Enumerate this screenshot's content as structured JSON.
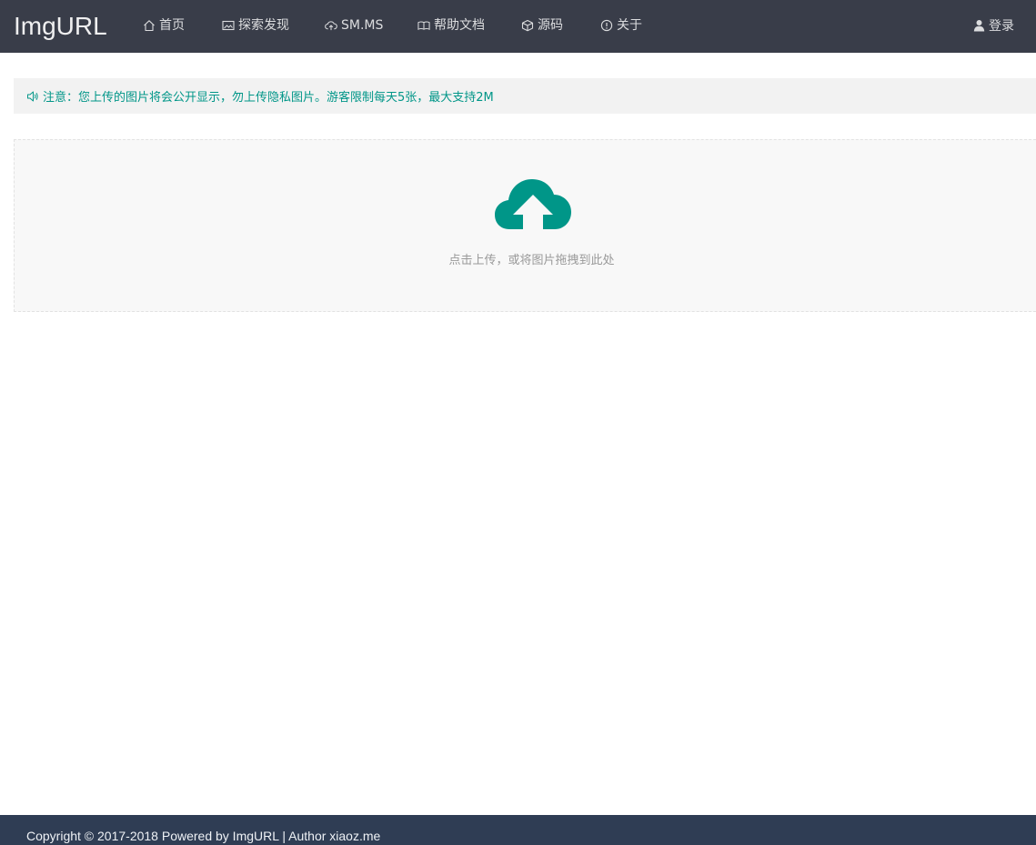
{
  "header": {
    "logo": "ImgURL",
    "nav": [
      {
        "label": "首页",
        "icon": "home-icon"
      },
      {
        "label": "探索发现",
        "icon": "picture-icon"
      },
      {
        "label": "SM.MS",
        "icon": "cloud-upload-icon"
      },
      {
        "label": "帮助文档",
        "icon": "book-icon"
      },
      {
        "label": "源码",
        "icon": "cube-icon"
      },
      {
        "label": "关于",
        "icon": "info-icon"
      }
    ],
    "login": {
      "label": "登录",
      "icon": "user-icon"
    }
  },
  "notice": {
    "icon": "speaker-icon",
    "text": "注意：您上传的图片将会公开显示，勿上传隐私图片。游客限制每天5张，最大支持2M"
  },
  "upload": {
    "icon": "cloud-upload-icon",
    "text": "点击上传，或将图片拖拽到此处"
  },
  "footer": {
    "text": "Copyright © 2017-2018 Powered by ImgURL | Author xiaoz.me"
  },
  "colors": {
    "header_bg": "#393d49",
    "accent": "#009688",
    "footer_bg": "#2f3d54"
  }
}
